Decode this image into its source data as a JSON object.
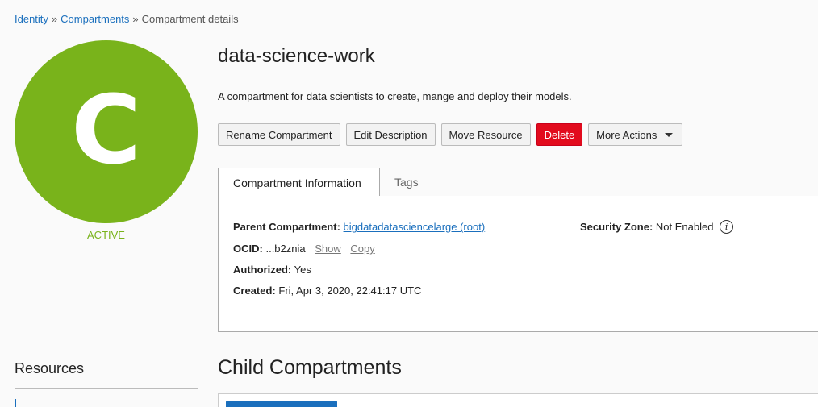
{
  "breadcrumb": {
    "identity": "Identity",
    "compartments": "Compartments",
    "current": "Compartment details",
    "separator": "»"
  },
  "avatar": {
    "letter": "C",
    "status": "ACTIVE",
    "color": "#79b31b"
  },
  "compartment": {
    "name": "data-science-work",
    "description": "A compartment for data scientists to create, mange and deploy their models."
  },
  "actions": {
    "rename": "Rename Compartment",
    "edit_description": "Edit Description",
    "move_resource": "Move Resource",
    "delete": "Delete",
    "more_actions": "More Actions"
  },
  "tabs": {
    "info": "Compartment Information",
    "tags": "Tags"
  },
  "info": {
    "parent_label": "Parent Compartment:",
    "parent_value": "bigdatadatasciencelarge (root)",
    "ocid_label": "OCID:",
    "ocid_value": "...b2znia",
    "ocid_show": "Show",
    "ocid_copy": "Copy",
    "authorized_label": "Authorized:",
    "authorized_value": "Yes",
    "created_label": "Created:",
    "created_value": "Fri, Apr 3, 2020, 22:41:17 UTC",
    "security_label": "Security Zone:",
    "security_value": "Not Enabled",
    "info_icon": "i"
  },
  "resources": {
    "title": "Resources"
  },
  "child": {
    "title": "Child Compartments"
  },
  "colors": {
    "accent": "#1a6fbd",
    "danger": "#e20b1d",
    "active": "#79b31b"
  }
}
